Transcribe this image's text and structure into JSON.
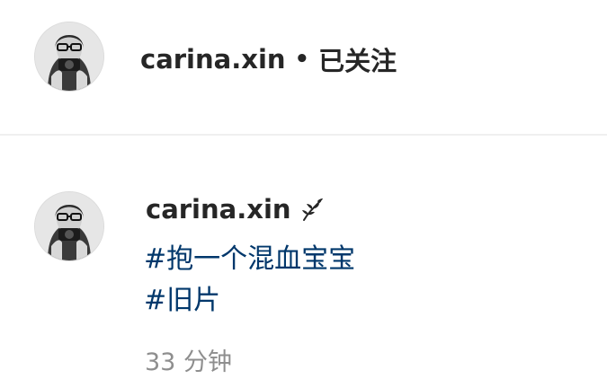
{
  "header": {
    "username": "carina.xin",
    "separator": "•",
    "follow_status": "已关注"
  },
  "comment": {
    "username": "carina.xin",
    "badge_icon": "sprout-icon",
    "hashtags": [
      "#抱一个混血宝宝",
      "#旧片"
    ],
    "timestamp": "33 分钟"
  },
  "colors": {
    "text": "#262626",
    "hashtag": "#00376b",
    "muted": "#8e8e8e",
    "divider": "#efefef"
  }
}
